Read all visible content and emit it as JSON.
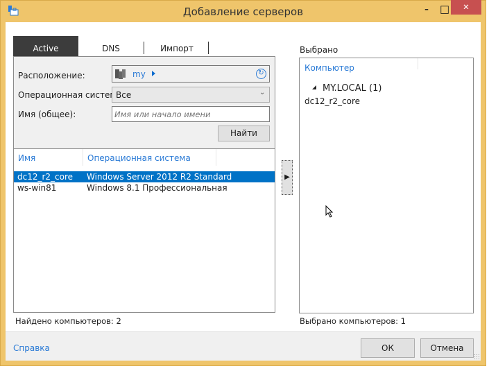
{
  "window": {
    "title": "Добавление серверов",
    "minimize": "–",
    "maximize": "□",
    "close": "✕",
    "close_color": "#c75050",
    "frame_color": "#efc56b"
  },
  "tabs": [
    {
      "label": "Active Directory",
      "active": true
    },
    {
      "label": "DNS"
    },
    {
      "label": "Импорт"
    }
  ],
  "form": {
    "location_label": "Расположение:",
    "location_value": "my",
    "os_label": "Операционная система:",
    "os_value": "Все",
    "name_label": "Имя (общее):",
    "name_placeholder": "Имя или начало имени",
    "name_value": "",
    "find_button": "Найти"
  },
  "results": {
    "columns": [
      "Имя",
      "Операционная система"
    ],
    "rows": [
      {
        "name": "dc12_r2_core",
        "os": "Windows Server 2012 R2 Standard",
        "selected": true
      },
      {
        "name": "ws-win81",
        "os": "Windows 8.1 Профессиональная",
        "selected": false
      }
    ],
    "status": "Найдено компьютеров: 2"
  },
  "add_button": "▶",
  "selected": {
    "label": "Выбрано",
    "column": "Компьютер",
    "group": "MY.LOCAL (1)",
    "items": [
      "dc12_r2_core"
    ],
    "status": "Выбрано компьютеров: 1"
  },
  "footer": {
    "help": "Справка",
    "ok": "ОК",
    "cancel": "Отмена"
  },
  "colors": {
    "accent": "#0072c6",
    "link": "#2b7bd6"
  }
}
